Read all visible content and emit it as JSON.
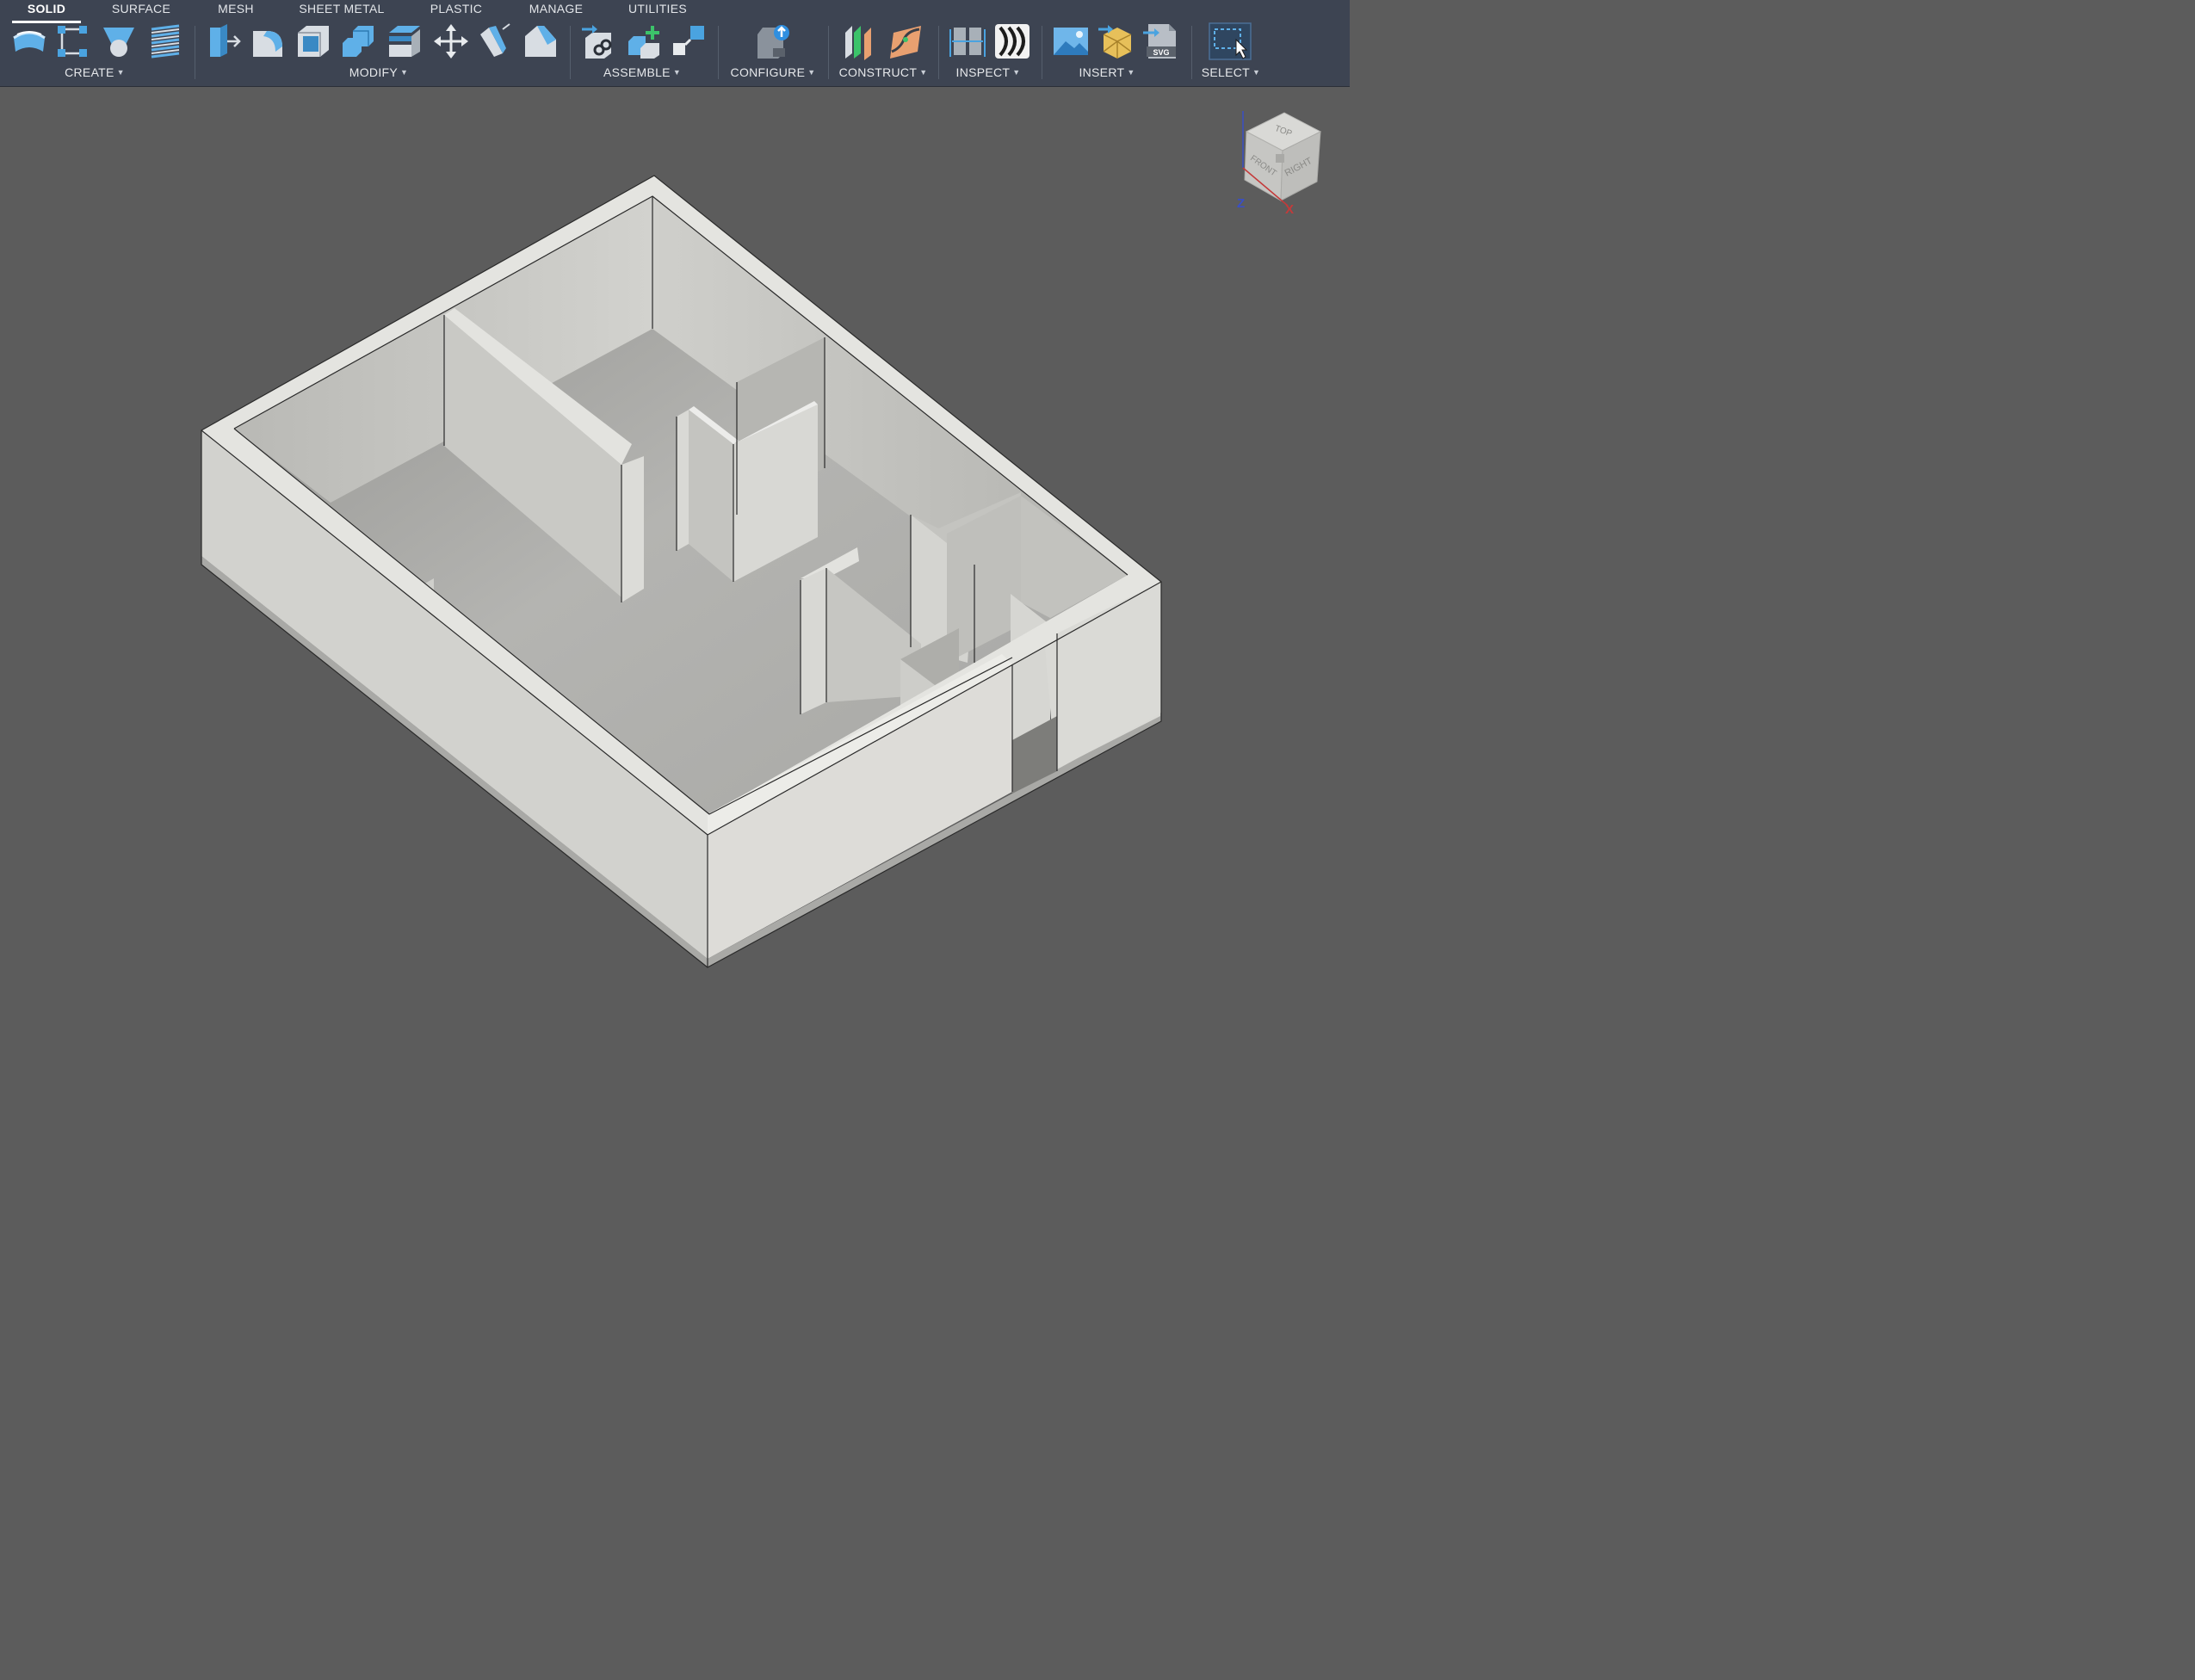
{
  "tabs": [
    {
      "label": "SOLID",
      "active": true
    },
    {
      "label": "SURFACE",
      "active": false
    },
    {
      "label": "MESH",
      "active": false
    },
    {
      "label": "SHEET METAL",
      "active": false
    },
    {
      "label": "PLASTIC",
      "active": false
    },
    {
      "label": "MANAGE",
      "active": false
    },
    {
      "label": "UTILITIES",
      "active": false
    }
  ],
  "groups": {
    "create": "CREATE",
    "modify": "MODIFY",
    "assemble": "ASSEMBLE",
    "configure": "CONFIGURE",
    "construct": "CONSTRUCT",
    "inspect": "INSPECT",
    "insert": "INSERT",
    "select": "SELECT"
  },
  "tools": {
    "create": [
      "new-component-icon",
      "create-sketch-icon",
      "extrude-icon",
      "coil-icon"
    ],
    "modify": [
      "press-pull-icon",
      "fillet-icon",
      "shell-icon",
      "combine-icon",
      "offset-face-icon",
      "move-copy-icon",
      "draft-icon",
      "chamfer-icon"
    ],
    "assemble": [
      "as-built-joint-icon",
      "new-component-plus-icon",
      "joint-icon"
    ],
    "configure": [
      "configure-icon"
    ],
    "construct": [
      "offset-plane-icon",
      "plane-along-path-icon"
    ],
    "inspect": [
      "measure-icon",
      "zebra-analysis-icon"
    ],
    "insert": [
      "insert-canvas-icon",
      "insert-mesh-icon",
      "insert-svg-icon"
    ],
    "select": [
      "window-select-icon"
    ]
  },
  "insert_svg_badge": "SVG",
  "viewcube": {
    "faces": {
      "top": "TOP",
      "front": "FRONT",
      "right": "RIGHT"
    },
    "axes": {
      "z": "Z",
      "x": "X"
    }
  },
  "colors": {
    "toolbar_bg": "#3d4452",
    "viewport_bg": "#5c5c5c",
    "model_light": "#d7d7d3",
    "model_mid": "#c2c2be",
    "model_floor": "#adadaa",
    "accent_blue": "#4aa3e0",
    "axis_z": "#3a4fc4",
    "axis_x": "#c43a3a"
  }
}
